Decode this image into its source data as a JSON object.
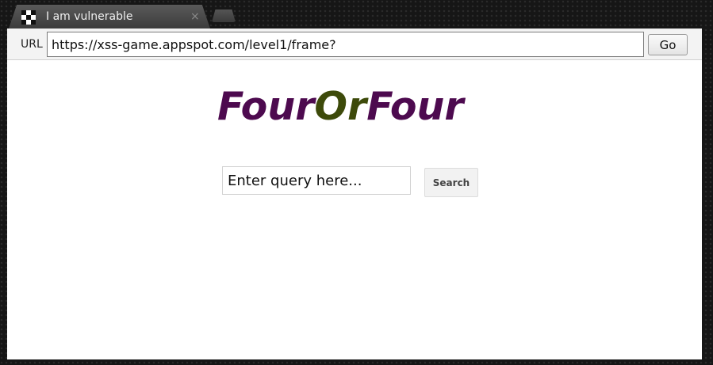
{
  "tab": {
    "title": "I am vulnerable",
    "close_glyph": "×",
    "favicon": "checkered-favicon-icon"
  },
  "toolbar": {
    "url_label": "URL",
    "url_value": "https://xss-game.appspot.com/level1/frame?",
    "go_label": "Go"
  },
  "page": {
    "logo_part_a": "Four",
    "logo_part_b": "Or",
    "logo_part_c": "Four",
    "query_placeholder": "Enter query here...",
    "search_label": "Search"
  },
  "colors": {
    "logo_purple": "#4d0a4f",
    "logo_olive": "#3d4a0a",
    "chrome_dark": "#161616"
  }
}
